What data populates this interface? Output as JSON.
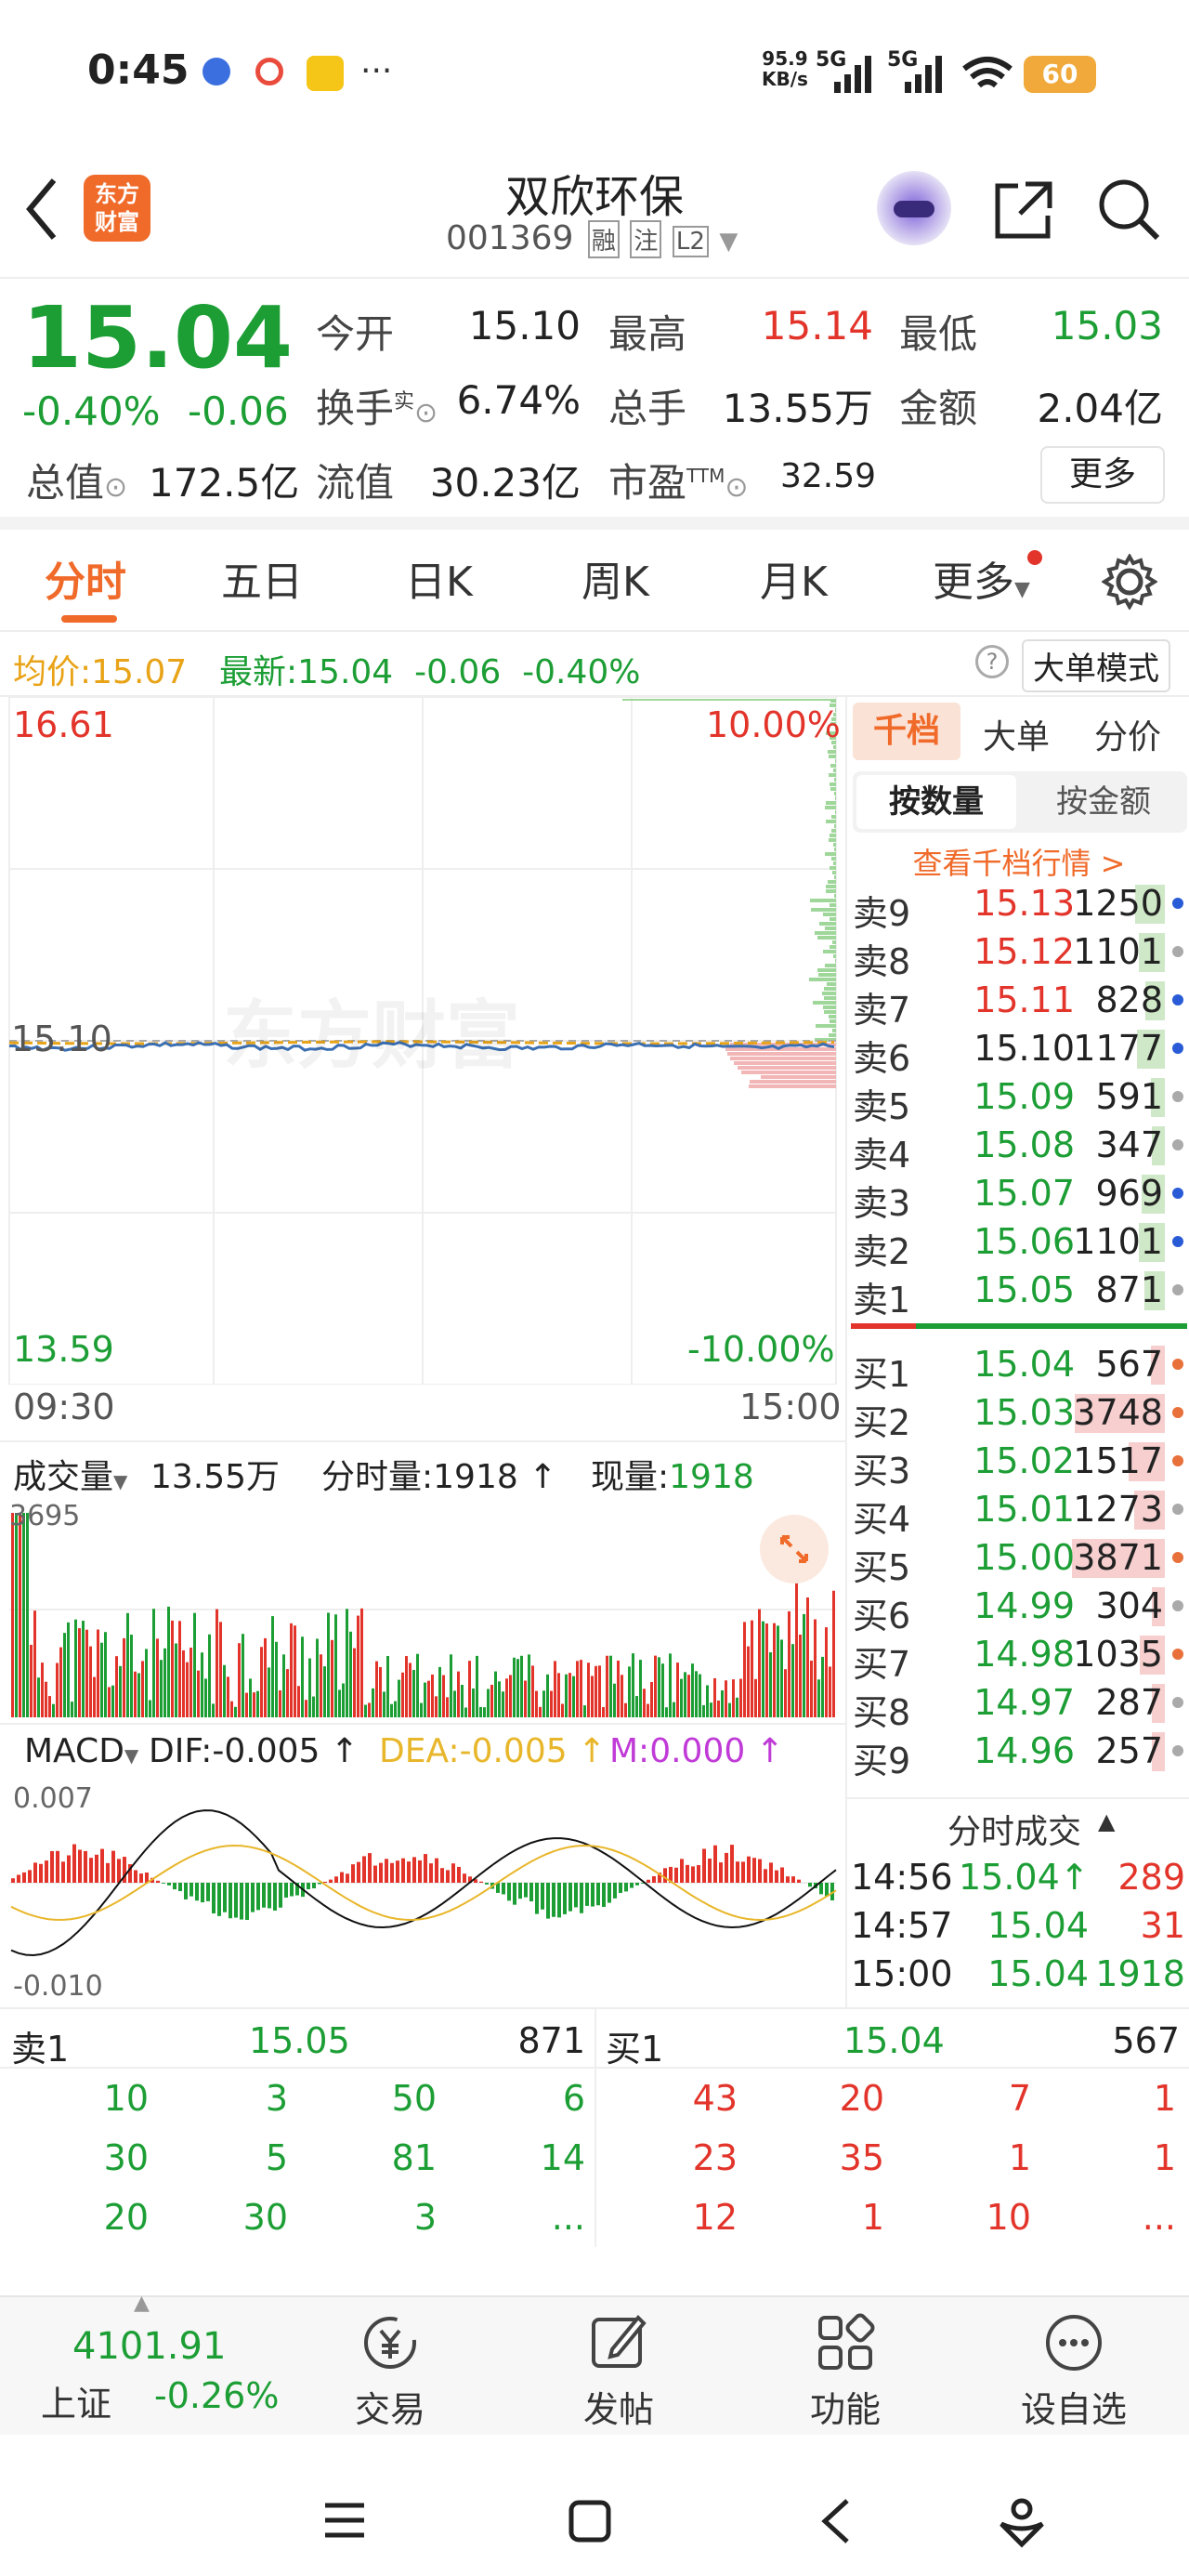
{
  "status_bar": {
    "time": "0:45",
    "net_speed_top": "95.9",
    "net_speed_bottom": "KB/s",
    "sig1": "5G",
    "sig2": "5G",
    "battery": "60"
  },
  "header": {
    "stock_name": "双欣环保",
    "stock_code": "001369",
    "tag_margin": "融",
    "tag_watch": "注",
    "tag_level": "L2",
    "logo_line1": "东方",
    "logo_line2": "财富"
  },
  "quote": {
    "price": "15.04",
    "change_pct": "-0.40%",
    "change": "-0.06",
    "open_label": "今开",
    "open": "15.10",
    "high_label": "最高",
    "high": "15.14",
    "low_label": "最低",
    "low": "15.03",
    "turnover_label": "换手",
    "turnover_sup": "实",
    "turnover": "6.74%",
    "volume_label": "总手",
    "volume": "13.55万",
    "amount_label": "金额",
    "amount": "2.04亿",
    "mktcap_label": "总值",
    "mktcap": "172.5亿",
    "float_label": "流值",
    "float_cap": "30.23亿",
    "pe_label": "市盈",
    "pe_sup": "TTM",
    "pe": "32.59",
    "more": "更多"
  },
  "tabs": [
    "分时",
    "五日",
    "日K",
    "周K",
    "月K",
    "更多"
  ],
  "avg_line": {
    "avg_label": "均价:",
    "avg_value": "15.07",
    "latest_label": "最新:",
    "latest_value": "15.04",
    "chg": "-0.06",
    "chg_pct": "-0.40%",
    "big_order_mode": "大单模式"
  },
  "chart": {
    "y_top": "16.61",
    "y_top_pct": "10.00%",
    "y_mid": "15.10",
    "y_bottom": "13.59",
    "y_bottom_pct": "-10.00%",
    "time_start": "09:30",
    "time_end": "15:00",
    "watermark": "东方财富"
  },
  "volume_panel": {
    "label": "成交量",
    "total": "13.55万",
    "minute_label": "分时量:",
    "minute_value": "1918",
    "now_label": "现量:",
    "now_value": "1918",
    "y_max": "3695"
  },
  "macd_panel": {
    "label": "MACD",
    "dif": "DIF:-0.005",
    "dea": "DEA:-0.005",
    "m": "M:0.000",
    "y_top": "0.007",
    "y_bottom": "-0.010"
  },
  "orderbook": {
    "tab_thousand": "千档",
    "tab_big": "大单",
    "tab_price": "分价",
    "by_qty": "按数量",
    "by_amount": "按金额",
    "view_link": "查看千档行情 >",
    "sell": [
      {
        "label": "卖9",
        "price": "15.13",
        "vol": "1250",
        "frac": 0.32,
        "color": "red",
        "dot": "#2a5bd7"
      },
      {
        "label": "卖8",
        "price": "15.12",
        "vol": "1101",
        "frac": 0.28,
        "color": "red",
        "dot": "#aaa"
      },
      {
        "label": "卖7",
        "price": "15.11",
        "vol": "828",
        "frac": 0.21,
        "color": "red",
        "dot": "#2a5bd7"
      },
      {
        "label": "卖6",
        "price": "15.10",
        "vol": "1177",
        "frac": 0.3,
        "color": "black",
        "dot": "#2a5bd7"
      },
      {
        "label": "卖5",
        "price": "15.09",
        "vol": "591",
        "frac": 0.15,
        "color": "green",
        "dot": "#aaa"
      },
      {
        "label": "卖4",
        "price": "15.08",
        "vol": "347",
        "frac": 0.09,
        "color": "green",
        "dot": "#aaa"
      },
      {
        "label": "卖3",
        "price": "15.07",
        "vol": "969",
        "frac": 0.25,
        "color": "green",
        "dot": "#2a5bd7"
      },
      {
        "label": "卖2",
        "price": "15.06",
        "vol": "1101",
        "frac": 0.28,
        "color": "green",
        "dot": "#2a5bd7"
      },
      {
        "label": "卖1",
        "price": "15.05",
        "vol": "871",
        "frac": 0.22,
        "color": "green",
        "dot": "#aaa"
      }
    ],
    "buy": [
      {
        "label": "买1",
        "price": "15.04",
        "vol": "567",
        "frac": 0.15,
        "color": "green",
        "dot": "#e8703a"
      },
      {
        "label": "买2",
        "price": "15.03",
        "vol": "3748",
        "frac": 0.97,
        "color": "green",
        "dot": "#e8703a"
      },
      {
        "label": "买3",
        "price": "15.02",
        "vol": "1517",
        "frac": 0.39,
        "color": "green",
        "dot": "#e8703a"
      },
      {
        "label": "买4",
        "price": "15.01",
        "vol": "1273",
        "frac": 0.33,
        "color": "green",
        "dot": "#aaa"
      },
      {
        "label": "买5",
        "price": "15.00",
        "vol": "3871",
        "frac": 1.0,
        "color": "green",
        "dot": "#e8703a"
      },
      {
        "label": "买6",
        "price": "14.99",
        "vol": "304",
        "frac": 0.08,
        "color": "green",
        "dot": "#aaa"
      },
      {
        "label": "买7",
        "price": "14.98",
        "vol": "1035",
        "frac": 0.27,
        "color": "green",
        "dot": "#e8703a"
      },
      {
        "label": "买8",
        "price": "14.97",
        "vol": "287",
        "frac": 0.07,
        "color": "green",
        "dot": "#aaa"
      },
      {
        "label": "买9",
        "price": "14.96",
        "vol": "257",
        "frac": 0.07,
        "color": "green",
        "dot": "#aaa"
      }
    ],
    "trades_title": "分时成交",
    "trades": [
      {
        "time": "14:56",
        "price": "15.04↑",
        "vol": "289",
        "vcolor": "red"
      },
      {
        "time": "14:57",
        "price": "15.04",
        "vol": "31",
        "vcolor": "red"
      },
      {
        "time": "15:00",
        "price": "15.04",
        "vol": "1918",
        "vcolor": "green"
      }
    ]
  },
  "detail": {
    "sell_label": "卖1",
    "sell_price": "15.05",
    "sell_vol": "871",
    "buy_label": "买1",
    "buy_price": "15.04",
    "buy_vol": "567",
    "sell_rows": [
      [
        "10",
        "3",
        "50",
        "6"
      ],
      [
        "30",
        "5",
        "81",
        "14"
      ],
      [
        "20",
        "30",
        "3",
        "..."
      ]
    ],
    "buy_rows": [
      [
        "43",
        "20",
        "7",
        "1"
      ],
      [
        "23",
        "35",
        "1",
        "1"
      ],
      [
        "12",
        "1",
        "10",
        "..."
      ]
    ]
  },
  "bottom_nav": {
    "index_value": "4101.91",
    "index_name": "上证",
    "index_chg": "-0.26%",
    "trade": "交易",
    "post": "发帖",
    "func": "功能",
    "watch": "设自选"
  },
  "colors": {
    "red": "#e2342a",
    "green": "#1c9e35",
    "accent": "#f06a2a"
  }
}
